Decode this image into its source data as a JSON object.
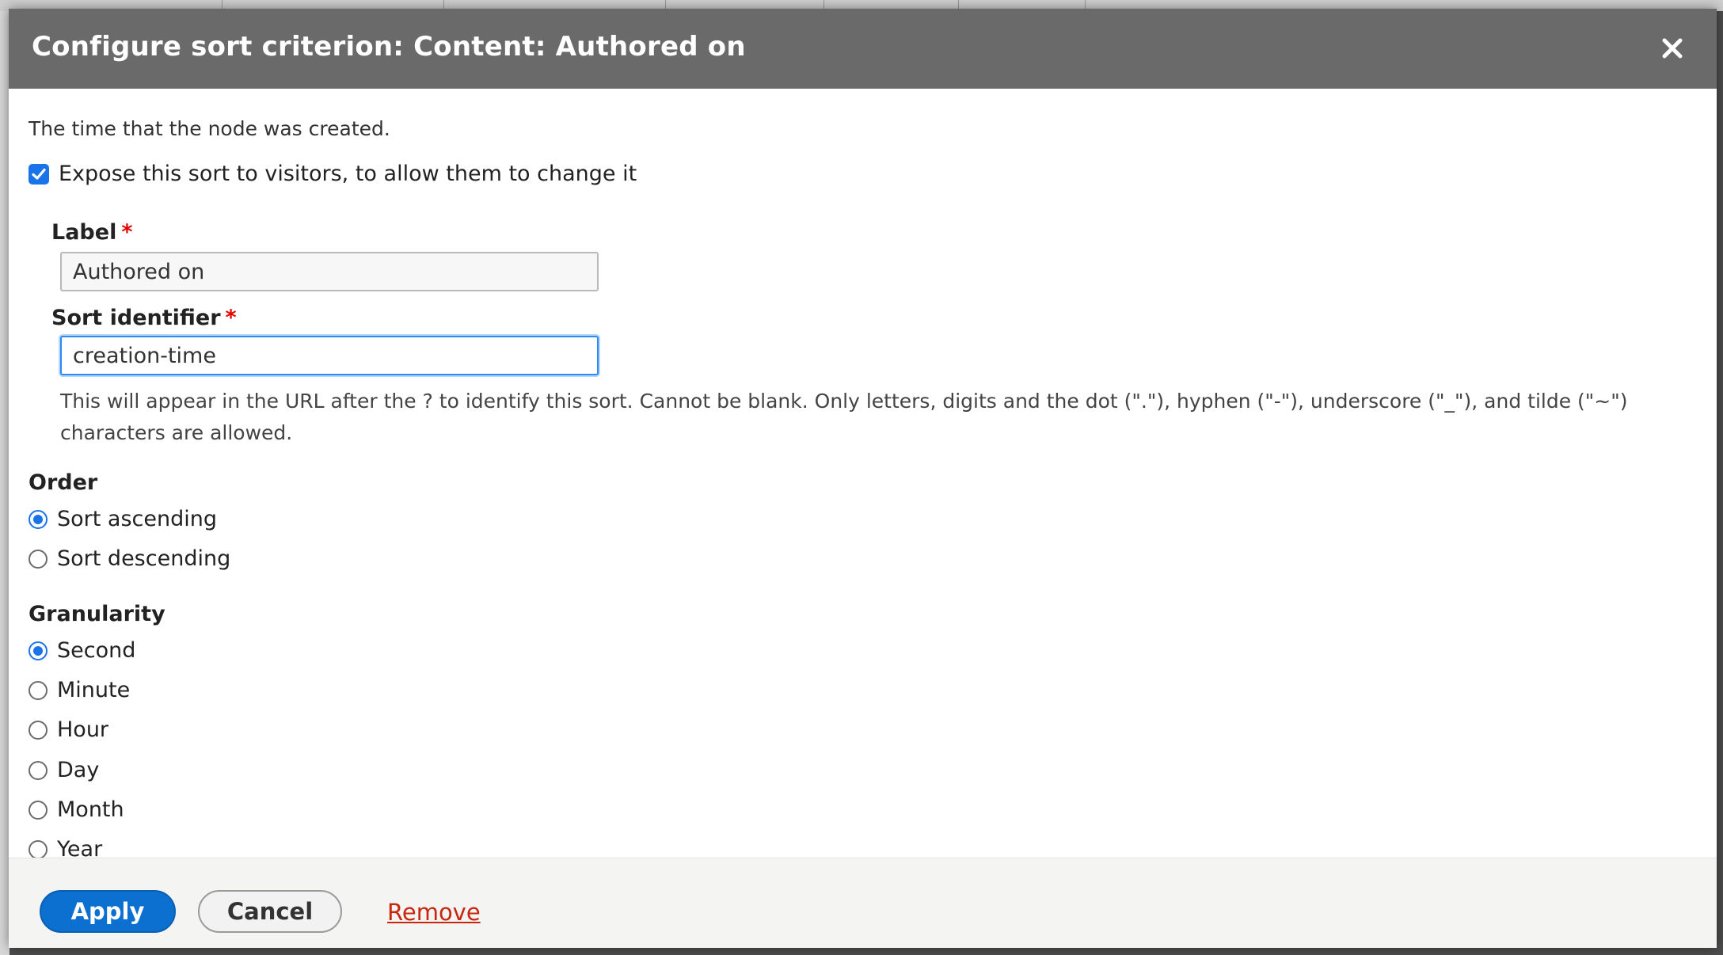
{
  "dialog": {
    "title": "Configure sort criterion: Content: Authored on",
    "description": "The time that the node was created."
  },
  "expose": {
    "checked": true,
    "label": "Expose this sort to visitors, to allow them to change it"
  },
  "label_field": {
    "label": "Label",
    "required_mark": "*",
    "value": "Authored on"
  },
  "sort_identifier": {
    "label": "Sort identifier",
    "required_mark": "*",
    "value": "creation-time",
    "help": "This will appear in the URL after the ? to identify this sort. Cannot be blank. Only letters, digits and the dot (\".\"), hyphen (\"-\"), underscore (\"_\"), and tilde (\"~\") characters are allowed."
  },
  "order": {
    "title": "Order",
    "options": [
      {
        "label": "Sort ascending",
        "selected": true
      },
      {
        "label": "Sort descending",
        "selected": false
      }
    ]
  },
  "granularity": {
    "title": "Granularity",
    "options": [
      {
        "label": "Second",
        "selected": true
      },
      {
        "label": "Minute",
        "selected": false
      },
      {
        "label": "Hour",
        "selected": false
      },
      {
        "label": "Day",
        "selected": false
      },
      {
        "label": "Month",
        "selected": false
      },
      {
        "label": "Year",
        "selected": false
      }
    ]
  },
  "footer": {
    "apply_label": "Apply",
    "cancel_label": "Cancel",
    "remove_label": "Remove"
  },
  "colors": {
    "titlebar": "#6a6a6a",
    "accent": "#1a73e8",
    "apply": "#0b70d0",
    "remove_link": "#c8260f",
    "required": "#e00000"
  }
}
